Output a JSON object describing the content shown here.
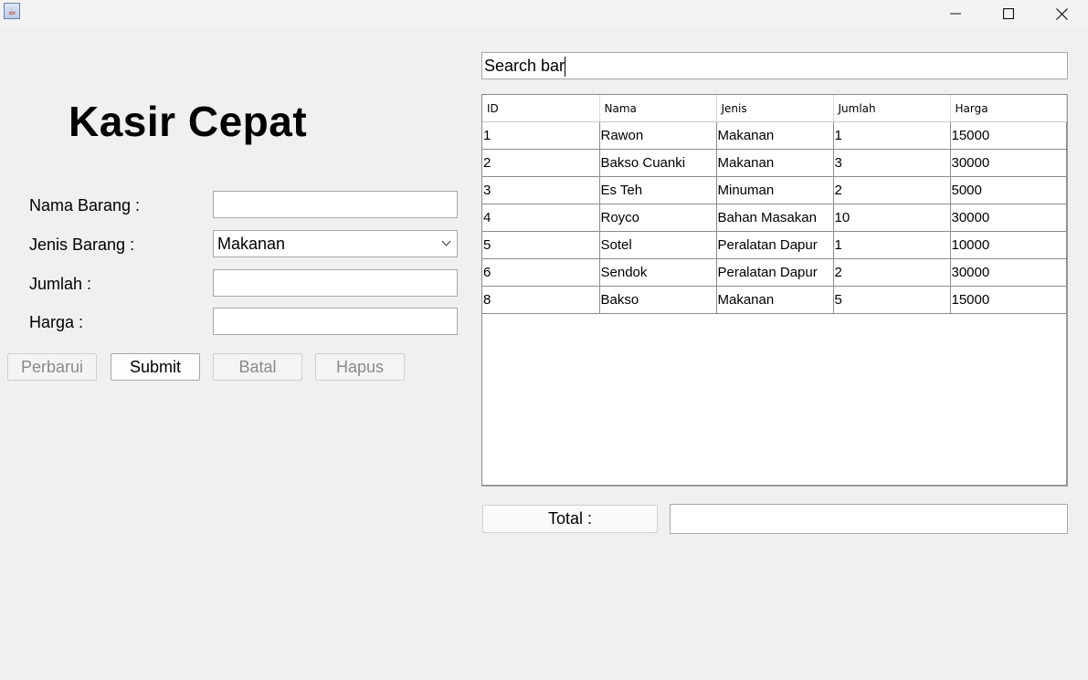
{
  "window": {
    "icon": "java-icon",
    "controls": {
      "minimize": "—",
      "maximize": "☐",
      "close": "✕"
    }
  },
  "title": "Kasir Cepat",
  "form": {
    "nama_label": "Nama Barang :",
    "nama_value": "",
    "jenis_label": "Jenis Barang :",
    "jenis_value": "Makanan",
    "jumlah_label": "Jumlah :",
    "jumlah_value": "",
    "harga_label": "Harga :",
    "harga_value": ""
  },
  "buttons": {
    "perbarui": "Perbarui",
    "submit": "Submit",
    "batal": "Batal",
    "hapus": "Hapus"
  },
  "search": {
    "value": "Search bar"
  },
  "table": {
    "columns": [
      "ID",
      "Nama",
      "Jenis",
      "Jumlah",
      "Harga"
    ],
    "rows": [
      [
        "1",
        "Rawon",
        "Makanan",
        "1",
        "15000"
      ],
      [
        "2",
        "Bakso Cuanki",
        "Makanan",
        "3",
        "30000"
      ],
      [
        "3",
        "Es Teh",
        "Minuman",
        "2",
        "5000"
      ],
      [
        "4",
        "Royco",
        "Bahan Masakan",
        "10",
        "30000"
      ],
      [
        "5",
        "Sotel",
        "Peralatan Dapur",
        "1",
        "10000"
      ],
      [
        "6",
        "Sendok",
        "Peralatan Dapur",
        "2",
        "30000"
      ],
      [
        "8",
        "Bakso",
        "Makanan",
        "5",
        "15000"
      ]
    ]
  },
  "total": {
    "label": "Total :",
    "value": ""
  }
}
